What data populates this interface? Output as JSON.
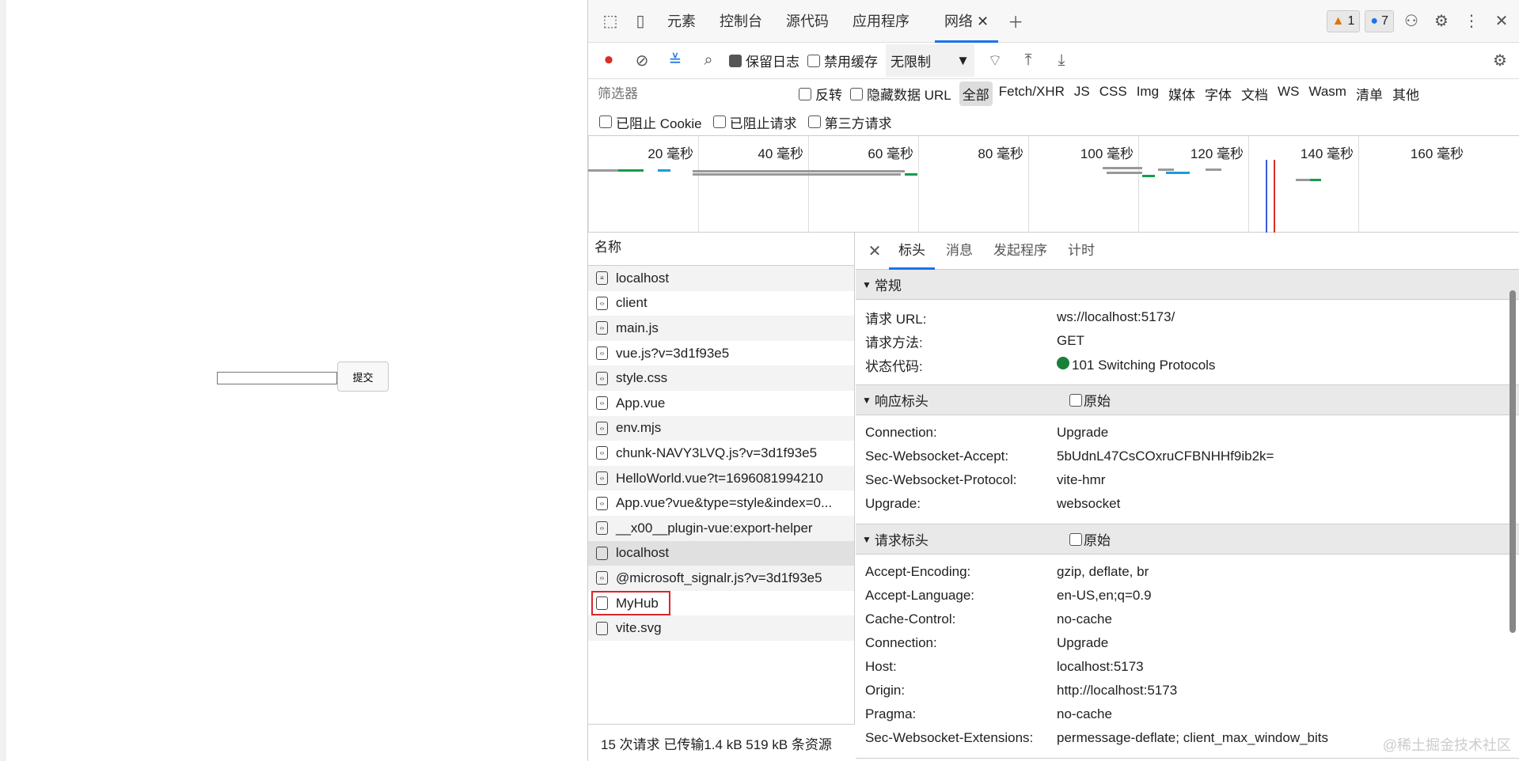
{
  "page": {
    "submit_label": "提交"
  },
  "devtools": {
    "tabs": [
      "元素",
      "控制台",
      "源代码",
      "应用程序",
      "网络"
    ],
    "warnings": "1",
    "messages": "7",
    "toolbar": {
      "preserve_log": "保留日志",
      "disable_cache": "禁用缓存",
      "throttle": "无限制"
    },
    "filter": {
      "placeholder": "筛选器",
      "invert": "反转",
      "hide_data_url": "隐藏数据 URL",
      "types": [
        "全部",
        "Fetch/XHR",
        "JS",
        "CSS",
        "Img",
        "媒体",
        "字体",
        "文档",
        "WS",
        "Wasm",
        "清单",
        "其他"
      ],
      "blocked_cookie": "已阻止 Cookie",
      "blocked_requests": "已阻止请求",
      "third_party": "第三方请求"
    },
    "timeline": [
      "20 毫秒",
      "40 毫秒",
      "60 毫秒",
      "80 毫秒",
      "100 毫秒",
      "120 毫秒",
      "140 毫秒",
      "160 毫秒"
    ],
    "names_header": "名称",
    "requests": [
      {
        "name": "localhost",
        "icon": "document"
      },
      {
        "name": "client",
        "icon": "script"
      },
      {
        "name": "main.js",
        "icon": "script"
      },
      {
        "name": "vue.js?v=3d1f93e5",
        "icon": "script"
      },
      {
        "name": "style.css",
        "icon": "script"
      },
      {
        "name": "App.vue",
        "icon": "script"
      },
      {
        "name": "env.mjs",
        "icon": "script"
      },
      {
        "name": "chunk-NAVY3LVQ.js?v=3d1f93e5",
        "icon": "script"
      },
      {
        "name": "HelloWorld.vue?t=1696081994210",
        "icon": "script"
      },
      {
        "name": "App.vue?vue&type=style&index=0...",
        "icon": "script"
      },
      {
        "name": "__x00__plugin-vue:export-helper",
        "icon": "script"
      },
      {
        "name": "localhost",
        "icon": "websocket"
      },
      {
        "name": "@microsoft_signalr.js?v=3d1f93e5",
        "icon": "script"
      },
      {
        "name": "MyHub",
        "icon": "websocket"
      },
      {
        "name": "vite.svg",
        "icon": "image"
      }
    ],
    "footer": "15 次请求  已传输1.4 kB  519 kB 条资源",
    "detail_tabs": [
      "标头",
      "消息",
      "发起程序",
      "计时"
    ],
    "general": {
      "title": "常规",
      "rows": [
        [
          "请求 URL:",
          "ws://localhost:5173/"
        ],
        [
          "请求方法:",
          "GET"
        ],
        [
          "状态代码:",
          "101 Switching Protocols"
        ]
      ]
    },
    "response": {
      "title": "响应标头",
      "raw": "原始",
      "rows": [
        [
          "Connection:",
          "Upgrade"
        ],
        [
          "Sec-Websocket-Accept:",
          "5bUdnL47CsCOxruCFBNHHf9ib2k="
        ],
        [
          "Sec-Websocket-Protocol:",
          "vite-hmr"
        ],
        [
          "Upgrade:",
          "websocket"
        ]
      ]
    },
    "request": {
      "title": "请求标头",
      "raw": "原始",
      "rows": [
        [
          "Accept-Encoding:",
          "gzip, deflate, br"
        ],
        [
          "Accept-Language:",
          "en-US,en;q=0.9"
        ],
        [
          "Cache-Control:",
          "no-cache"
        ],
        [
          "Connection:",
          "Upgrade"
        ],
        [
          "Host:",
          "localhost:5173"
        ],
        [
          "Origin:",
          "http://localhost:5173"
        ],
        [
          "Pragma:",
          "no-cache"
        ],
        [
          "Sec-Websocket-Extensions:",
          "permessage-deflate; client_max_window_bits"
        ]
      ]
    },
    "watermark": "@稀土掘金技术社区"
  }
}
